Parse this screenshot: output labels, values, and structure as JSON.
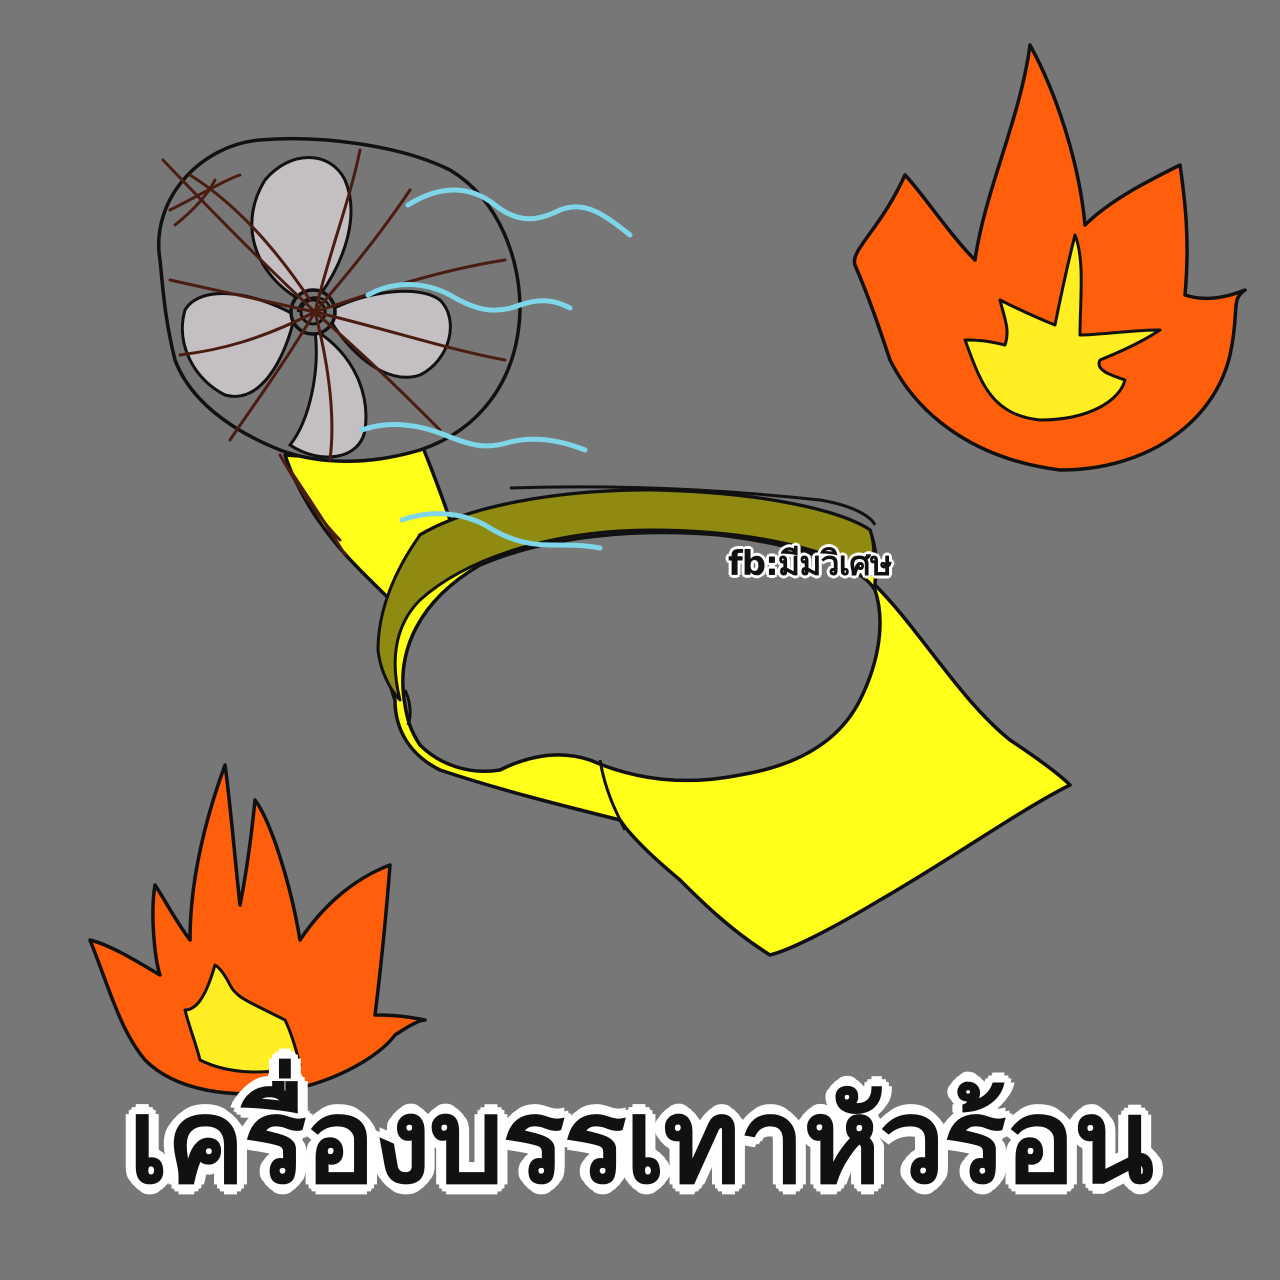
{
  "watermark": "fb:มีมวิเศษ",
  "caption": "เครื่องบรรเทาหัวร้อน",
  "colors": {
    "background": "#777777",
    "flame_outer": "#ff5f0a",
    "flame_inner": "#ffee22",
    "neck_fan_band": "#ffff1a",
    "band_inner": "#8f8a12",
    "fan_blade": "#c4bfc2",
    "wind_lines": "#7fd6e8",
    "cage_wires": "#4a1d12",
    "outline": "#111111"
  },
  "icons": [
    "flame-icon",
    "neck-fan-icon",
    "wind-icon"
  ]
}
